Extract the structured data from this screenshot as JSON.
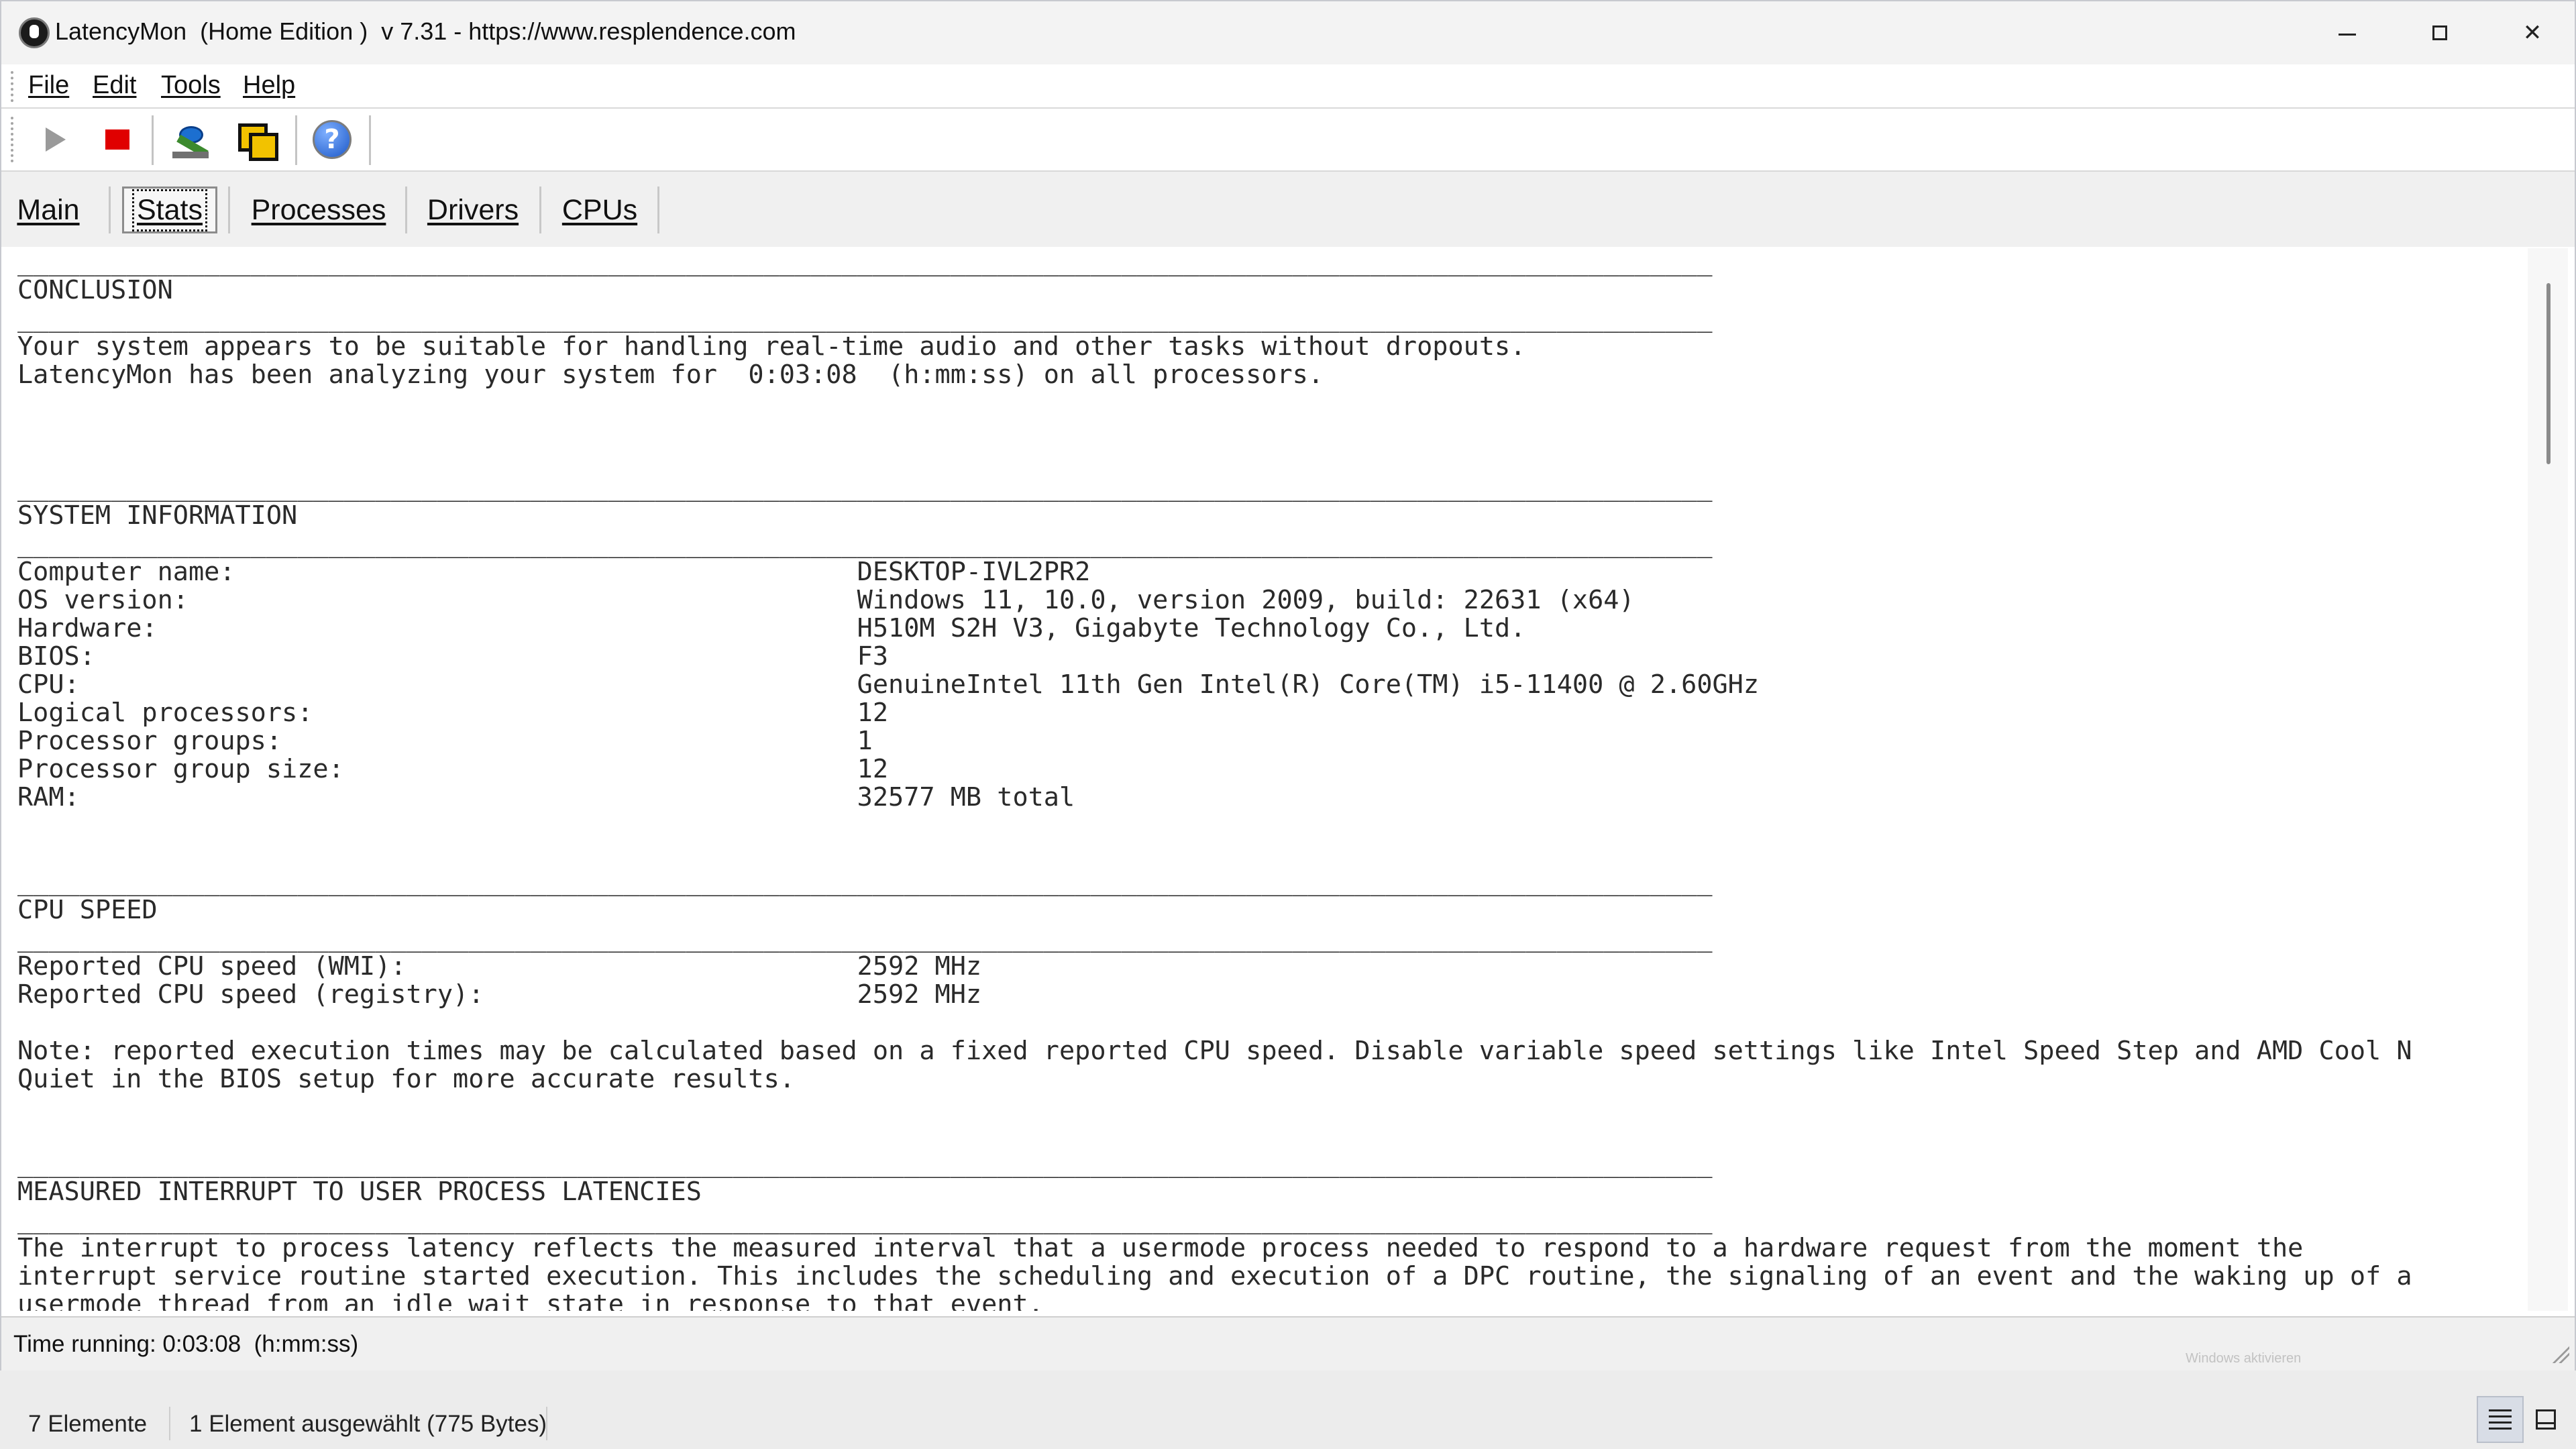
{
  "window": {
    "title": "LatencyMon  (Home Edition )  v 7.31 - https://www.resplendence.com",
    "min_symbol": "",
    "max_symbol": "",
    "close_symbol": "✕"
  },
  "menu": [
    "File",
    "Edit",
    "Tools",
    "Help"
  ],
  "toolbar": {
    "icons": [
      "play-icon",
      "stop-icon",
      "tools-icon",
      "cpu-icon",
      "help-icon"
    ],
    "help_glyph": "?"
  },
  "tabs": [
    {
      "label": "Main",
      "active": false
    },
    {
      "label": "Stats",
      "active": true
    },
    {
      "label": "Processes",
      "active": false
    },
    {
      "label": "Drivers",
      "active": false
    },
    {
      "label": "CPUs",
      "active": false
    }
  ],
  "report": {
    "text": "_____________________________________________________________________________________________________________\nCONCLUSION\n_____________________________________________________________________________________________________________\nYour system appears to be suitable for handling real-time audio and other tasks without dropouts.\nLatencyMon has been analyzing your system for  0:03:08  (h:mm:ss) on all processors.\n\n\n\n_____________________________________________________________________________________________________________\nSYSTEM INFORMATION\n_____________________________________________________________________________________________________________\nComputer name:                                        DESKTOP-IVL2PR2\nOS version:                                           Windows 11, 10.0, version 2009, build: 22631 (x64)\nHardware:                                             H510M S2H V3, Gigabyte Technology Co., Ltd.\nBIOS:                                                 F3\nCPU:                                                  GenuineIntel 11th Gen Intel(R) Core(TM) i5-11400 @ 2.60GHz\nLogical processors:                                   12\nProcessor groups:                                     1\nProcessor group size:                                 12\nRAM:                                                  32577 MB total\n\n\n_____________________________________________________________________________________________________________\nCPU SPEED\n_____________________________________________________________________________________________________________\nReported CPU speed (WMI):                             2592 MHz\nReported CPU speed (registry):                        2592 MHz\n\nNote: reported execution times may be calculated based on a fixed reported CPU speed. Disable variable speed settings like Intel Speed Step and AMD Cool N\nQuiet in the BIOS setup for more accurate results.\n\n\n_____________________________________________________________________________________________________________\nMEASURED INTERRUPT TO USER PROCESS LATENCIES\n_____________________________________________________________________________________________________________\nThe interrupt to process latency reflects the measured interval that a usermode process needed to respond to a hardware request from the moment the\ninterrupt service routine started execution. This includes the scheduling and execution of a DPC routine, the signaling of an event and the waking up of a\nusermode thread from an idle wait state in response to that event."
  },
  "status": {
    "time_running": "Time running: 0:03:08  (h:mm:ss)",
    "watermark": "Windows aktivieren"
  },
  "explorer": {
    "item_count": "7 Elemente",
    "selection": "1 Element ausgewählt (775 Bytes)"
  }
}
